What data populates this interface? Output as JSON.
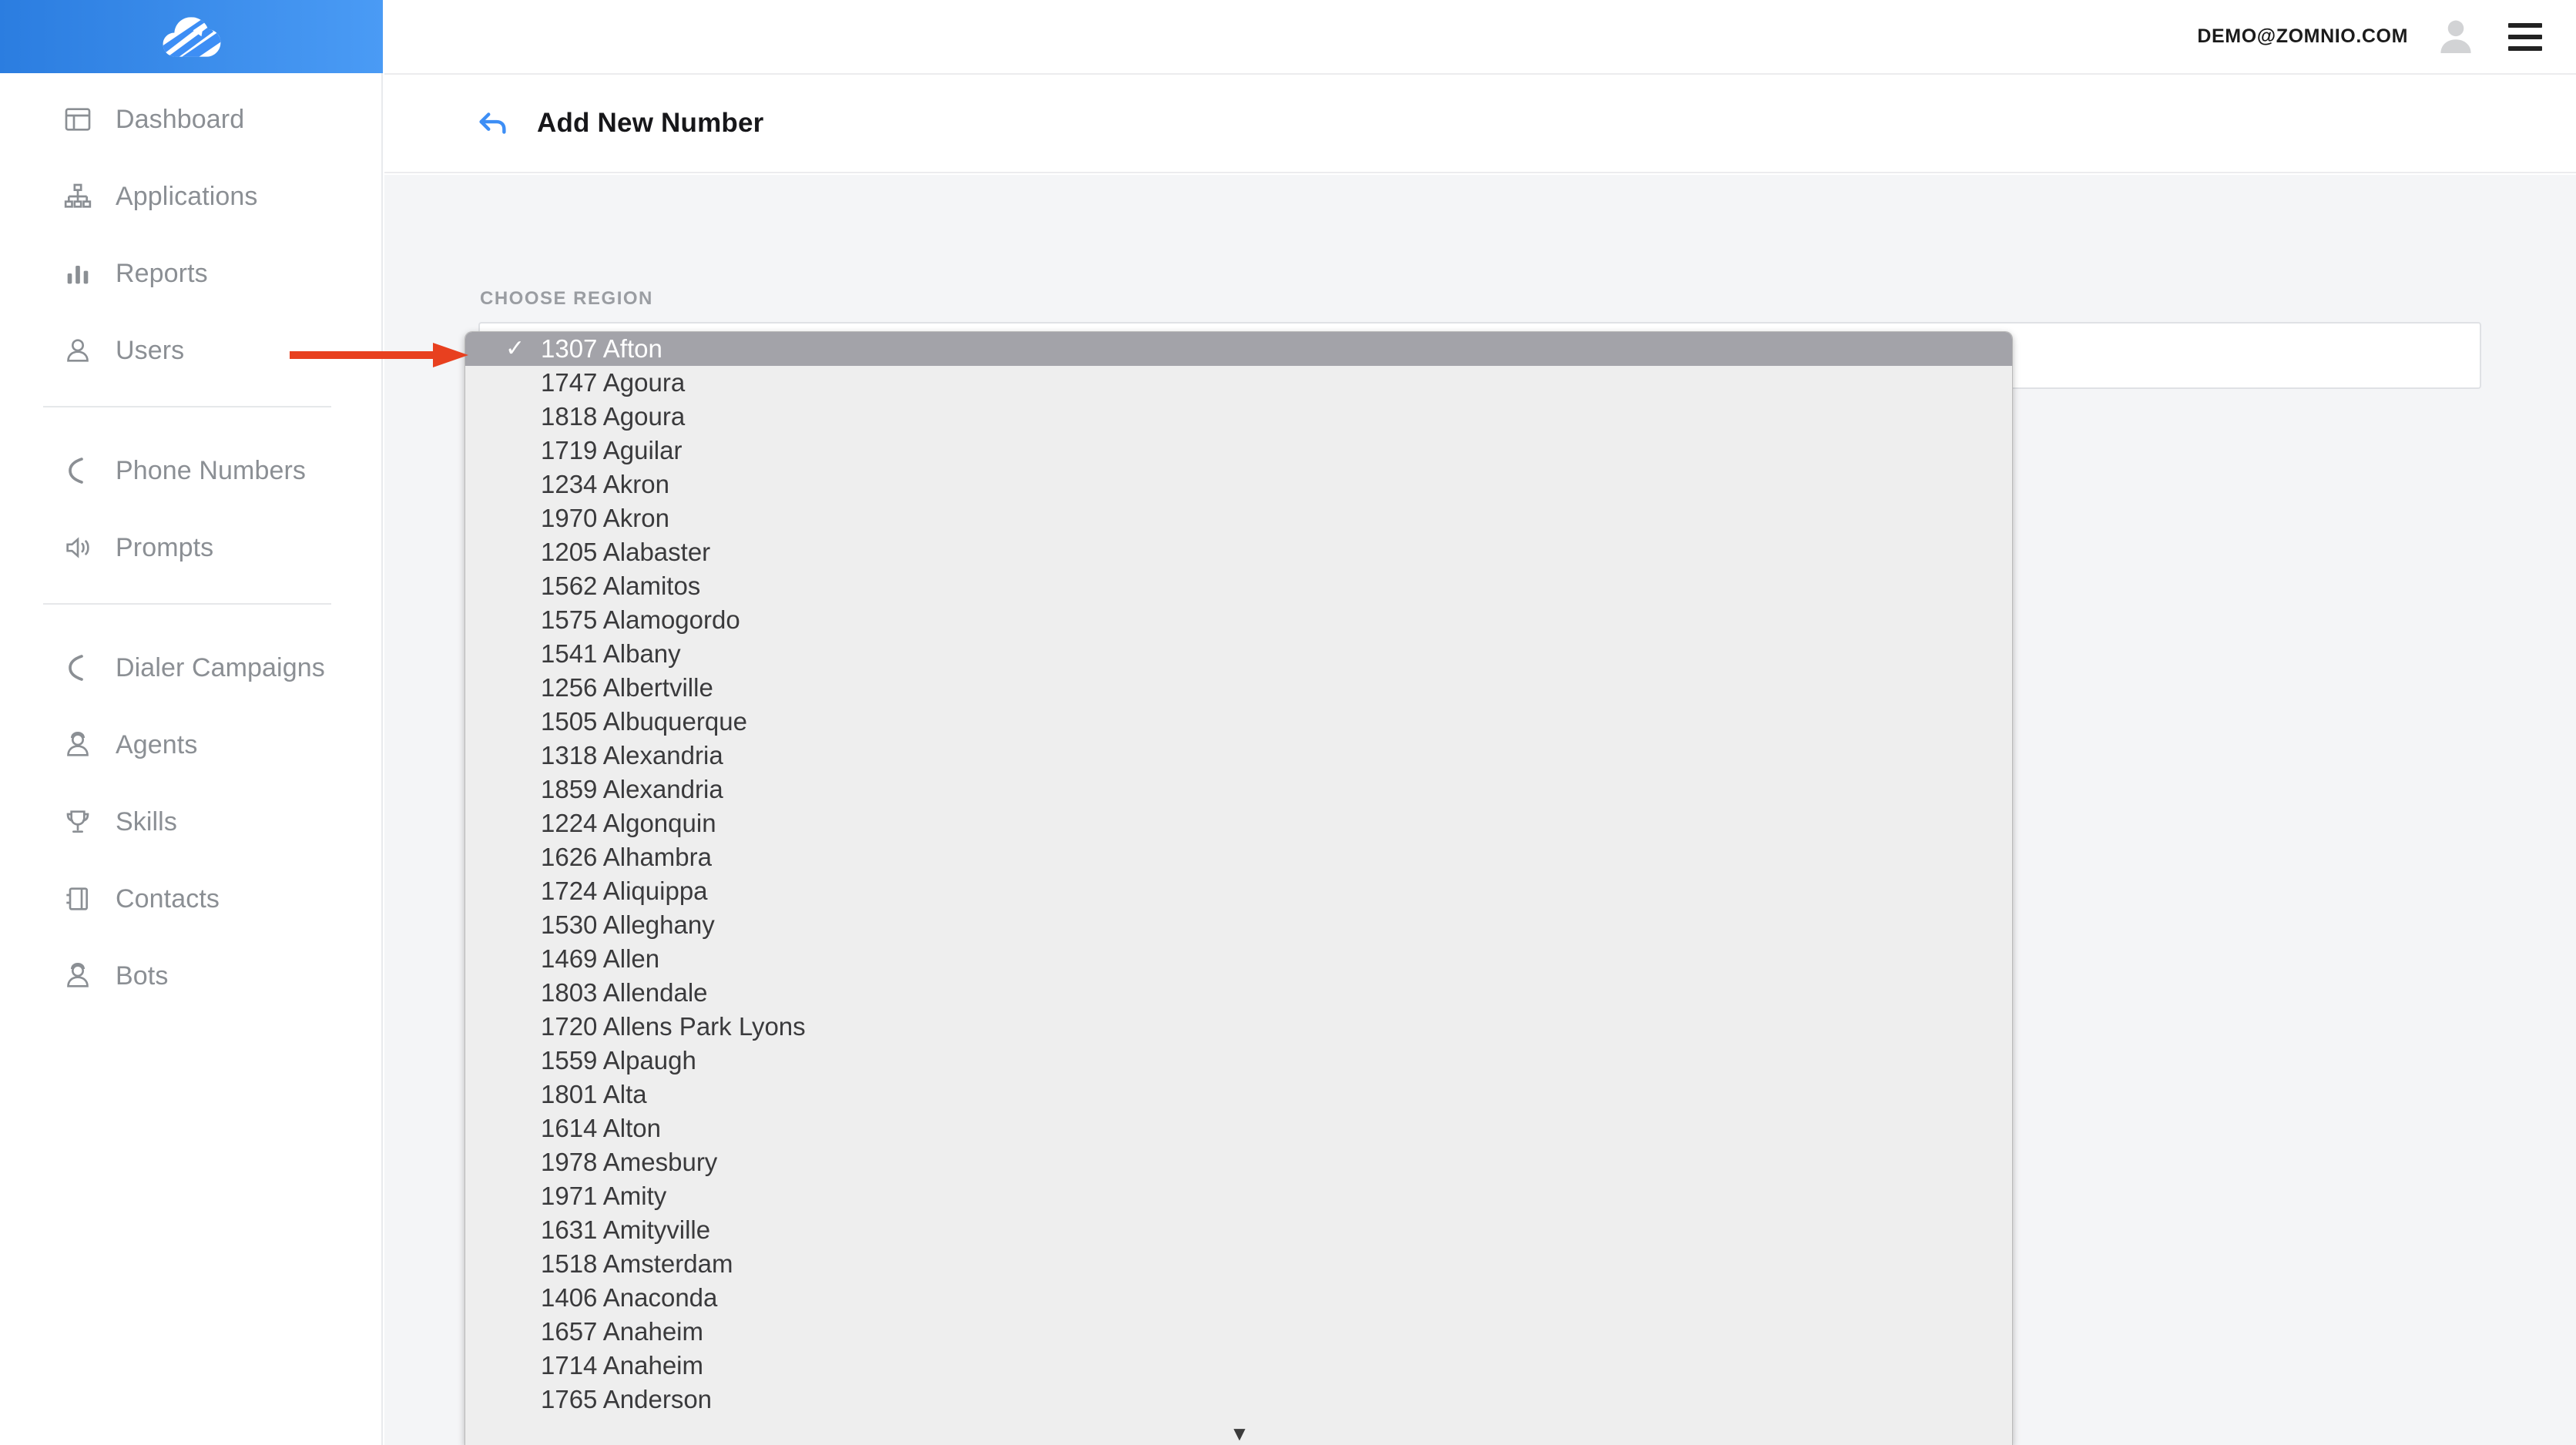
{
  "brand": {
    "logo_icon": "cloud-swoosh-logo",
    "accent_color": "#3d8ef5"
  },
  "topbar": {
    "user_email": "DEMO@ZOMNIO.COM",
    "avatar_icon": "user-avatar-icon",
    "menu_icon": "hamburger-menu-icon"
  },
  "sidebar": {
    "groups": [
      {
        "items": [
          {
            "label": "Dashboard",
            "icon": "dashboard-window-icon"
          },
          {
            "label": "Applications",
            "icon": "sitemap-icon"
          },
          {
            "label": "Reports",
            "icon": "bar-chart-icon"
          },
          {
            "label": "Users",
            "icon": "user-icon"
          }
        ]
      },
      {
        "items": [
          {
            "label": "Phone Numbers",
            "icon": "phone-icon"
          },
          {
            "label": "Prompts",
            "icon": "speaker-icon"
          }
        ]
      },
      {
        "items": [
          {
            "label": "Dialer Campaigns",
            "icon": "phone-icon"
          },
          {
            "label": "Agents",
            "icon": "headset-agent-icon"
          },
          {
            "label": "Skills",
            "icon": "trophy-icon"
          },
          {
            "label": "Contacts",
            "icon": "contact-card-icon"
          },
          {
            "label": "Bots",
            "icon": "bot-icon"
          }
        ]
      }
    ]
  },
  "page": {
    "back_icon": "back-arrow-icon",
    "title": "Add New Number"
  },
  "form": {
    "region_label": "CHOOSE REGION",
    "region_value": "",
    "region_placeholder": ""
  },
  "dropdown": {
    "selected_index": 0,
    "check_glyph": "✓",
    "scroll_down_glyph": "▼",
    "options": [
      "1307 Afton",
      "1747 Agoura",
      "1818 Agoura",
      "1719 Aguilar",
      "1234 Akron",
      "1970 Akron",
      "1205 Alabaster",
      "1562 Alamitos",
      "1575 Alamogordo",
      "1541 Albany",
      "1256 Albertville",
      "1505 Albuquerque",
      "1318 Alexandria",
      "1859 Alexandria",
      "1224 Algonquin",
      "1626 Alhambra",
      "1724 Aliquippa",
      "1530 Alleghany",
      "1469 Allen",
      "1803 Allendale",
      "1720 Allens Park Lyons",
      "1559 Alpaugh",
      "1801 Alta",
      "1614 Alton",
      "1978 Amesbury",
      "1971 Amity",
      "1631 Amityville",
      "1518 Amsterdam",
      "1406 Anaconda",
      "1657 Anaheim",
      "1714 Anaheim",
      "1765 Anderson"
    ]
  },
  "annotation": {
    "arrow_icon": "pointer-arrow-icon",
    "color": "#e8401f"
  }
}
